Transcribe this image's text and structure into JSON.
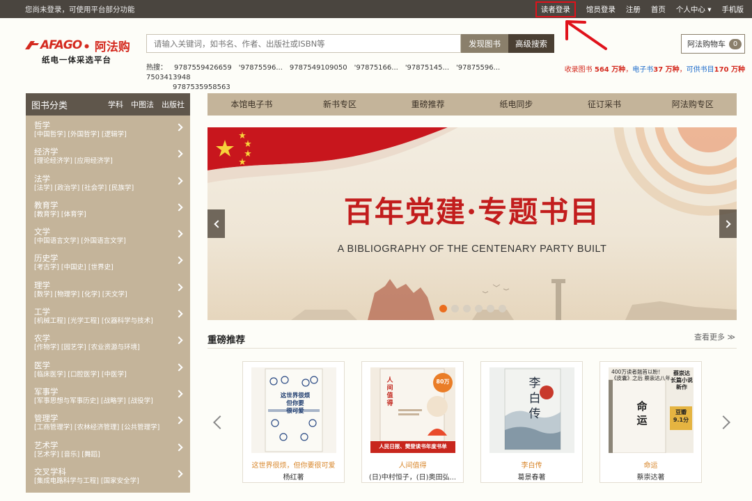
{
  "topbar": {
    "notice": "您尚未登录，可使用平台部分功能",
    "links": [
      {
        "label": "读者登录",
        "highlighted": true
      },
      {
        "label": "馆员登录"
      },
      {
        "label": "注册"
      },
      {
        "label": "首页"
      },
      {
        "label": "个人中心 ▾"
      },
      {
        "label": "手机版"
      }
    ]
  },
  "logo": {
    "brand_en": "AFAGO",
    "brand_cn": "• 阿法购",
    "slogan": "纸电一体采选平台"
  },
  "search": {
    "placeholder": "请输入关键词，如书名、作者、出版社或ISBN等",
    "find_label": "发现图书",
    "advanced_label": "高级搜索"
  },
  "cart": {
    "label": "阿法购物车",
    "count": "0"
  },
  "hot_search": {
    "label": "热搜：",
    "terms": [
      "9787559426659",
      "'97875596...",
      "9787549109050",
      "'97875166...",
      "'97875145...",
      "'97875596...",
      "7503413948",
      "9787535958563"
    ]
  },
  "stats": {
    "print_prefix": "收录图书 ",
    "print_value": "564 万种",
    "sep1": "，",
    "ebook_prefix": "电子书",
    "ebook_value": "37 万种",
    "sep2": "，",
    "supply_prefix": "可供书目",
    "supply_value": "170 万种"
  },
  "sidebar": {
    "title": "图书分类",
    "tabs": [
      "学科",
      "中图法",
      "出版社"
    ],
    "categories": [
      {
        "name": "哲学",
        "subs": "[中国哲学] [外国哲学] [逻辑学]"
      },
      {
        "name": "经济学",
        "subs": "[理论经济学] [应用经济学]"
      },
      {
        "name": "法学",
        "subs": "[法学] [政治学] [社会学] [民族学]"
      },
      {
        "name": "教育学",
        "subs": "[教育学] [体育学]"
      },
      {
        "name": "文学",
        "subs": "[中国语言文学] [外国语言文学]"
      },
      {
        "name": "历史学",
        "subs": "[考古学] [中国史] [世界史]"
      },
      {
        "name": "理学",
        "subs": "[数学] [物理学] [化学] [天文学]"
      },
      {
        "name": "工学",
        "subs": "[机械工程] [光学工程] [仪器科学与技术]"
      },
      {
        "name": "农学",
        "subs": "[作物学] [园艺学] [农业资源与环境]"
      },
      {
        "name": "医学",
        "subs": "[临床医学] [口腔医学] [中医学]"
      },
      {
        "name": "军事学",
        "subs": "[军事思想与军事历史] [战略学] [战役学]"
      },
      {
        "name": "管理学",
        "subs": "[工商管理学] [农林经济管理] [公共管理学]"
      },
      {
        "name": "艺术学",
        "subs": "[艺术学] [音乐] [舞蹈]"
      },
      {
        "name": "交叉学科",
        "subs": "[集成电路科学与工程] [国家安全学]"
      }
    ]
  },
  "mainnav": [
    "本馆电子书",
    "新书专区",
    "重磅推荐",
    "纸电同步",
    "征订采书",
    "阿法购专区"
  ],
  "banner": {
    "title": "百年党建·专题书目",
    "subtitle": "A BIBLIOGRAPHY OF THE CENTENARY PARTY BUILT",
    "active_dot": 1
  },
  "section": {
    "title": "重磅推荐",
    "more": "查看更多 ≫"
  },
  "books": [
    {
      "title": "这世界很烦，但你要很可爱",
      "author": "杨红著",
      "cover": {
        "lines": [
          "这世界很烦",
          "但你要",
          "很可爱"
        ],
        "bg": "#f6f3ec",
        "fg": "#1d3b6e"
      }
    },
    {
      "title": "人间值得",
      "author": "(日)中村恒子，(日)奥田弘...",
      "cover": {
        "lines": [
          "人间值得"
        ],
        "badge": "80万",
        "ribbon": "人民日报、樊登读书年度书单",
        "bg": "#f4ede4",
        "fg": "#c2261d"
      }
    },
    {
      "title": "李白传",
      "author": "葛景春著",
      "cover": {
        "lines": [
          "李",
          "白",
          "传"
        ],
        "bg": "#eef0ee",
        "fg": "#1f2a3a"
      }
    },
    {
      "title": "命运",
      "author": "蔡崇达著",
      "cover": {
        "lines": [
          "命",
          "运"
        ],
        "top": "400万读者翘首以盼！",
        "top2": "《皮囊》之后 蔡崇达八年",
        "side": "蔡崇达 长篇小说新作",
        "bean": "豆瓣",
        "score": "9.1分",
        "bg": "#f1ede4",
        "fg": "#222"
      }
    }
  ]
}
